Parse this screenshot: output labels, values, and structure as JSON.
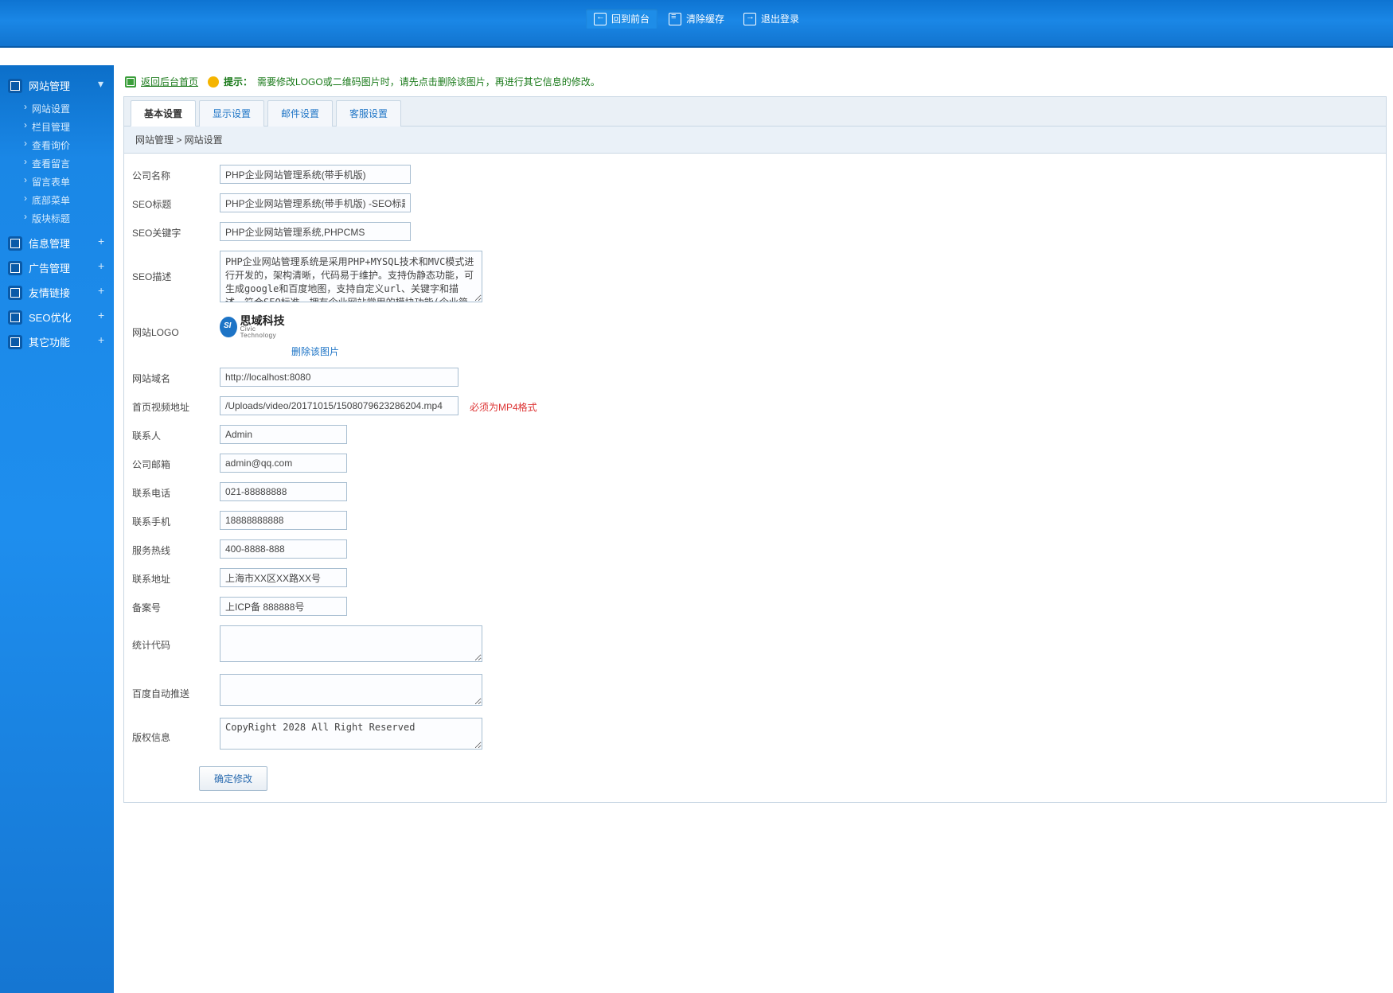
{
  "header": {
    "back_front": "回到前台",
    "clear_cache": "清除缓存",
    "logout": "退出登录"
  },
  "sidebar": {
    "groups": [
      {
        "title": "网站管理",
        "toggle": "▾",
        "open": true,
        "items": [
          "网站设置",
          "栏目管理",
          "查看询价",
          "查看留言",
          "留言表单",
          "底部菜单",
          "版块标题"
        ]
      },
      {
        "title": "信息管理",
        "toggle": "+"
      },
      {
        "title": "广告管理",
        "toggle": "+"
      },
      {
        "title": "友情链接",
        "toggle": "+"
      },
      {
        "title": "SEO优化",
        "toggle": "+"
      },
      {
        "title": "其它功能",
        "toggle": "+"
      }
    ]
  },
  "notice": {
    "back_link": "返回后台首页",
    "tip_label": "提示：",
    "tip_text": "需要修改LOGO或二维码图片时，请先点击删除该图片，再进行其它信息的修改。"
  },
  "tabs": [
    "基本设置",
    "显示设置",
    "邮件设置",
    "客服设置"
  ],
  "breadcrumb": "网站管理 > 网站设置",
  "form": {
    "company_name": {
      "label": "公司名称",
      "value": "PHP企业网站管理系统(带手机版)"
    },
    "seo_title": {
      "label": "SEO标题",
      "value": "PHP企业网站管理系统(带手机版) -SEO标题优化"
    },
    "seo_keywords": {
      "label": "SEO关键字",
      "value": "PHP企业网站管理系统,PHPCMS"
    },
    "seo_desc": {
      "label": "SEO描述",
      "value": "PHP企业网站管理系统是采用PHP+MYSQL技术和MVC模式进行开发的，架构清晰，代码易于维护。支持伪静态功能，可生成google和百度地图，支持自定义url、关键字和描述，符合SEO标准。拥有企业网站常用的模块功能(企业简介模块、新闻模块、产品模块、下载模块、"
    },
    "site_logo": {
      "label": "网站LOGO",
      "logo_cn": "思域科技",
      "logo_en": "Civic Technology",
      "delete_link": "删除该图片"
    },
    "site_domain": {
      "label": "网站域名",
      "value": "http://localhost:8080"
    },
    "home_video": {
      "label": "首页视频地址",
      "value": "/Uploads/video/20171015/1508079623286204.mp4",
      "note": "必须为MP4格式"
    },
    "contact": {
      "label": "联系人",
      "value": "Admin"
    },
    "email": {
      "label": "公司邮箱",
      "value": "admin@qq.com"
    },
    "tel": {
      "label": "联系电话",
      "value": "021-88888888"
    },
    "mobile": {
      "label": "联系手机",
      "value": "18888888888"
    },
    "hotline": {
      "label": "服务热线",
      "value": "400-8888-888"
    },
    "address": {
      "label": "联系地址",
      "value": "上海市XX区XX路XX号"
    },
    "icp": {
      "label": "备案号",
      "value": "上ICP备 888888号"
    },
    "stats_code": {
      "label": "统计代码",
      "value": ""
    },
    "baidu_push": {
      "label": "百度自动推送",
      "value": ""
    },
    "copyright": {
      "label": "版权信息",
      "value": "CopyRight 2028 All Right Reserved"
    },
    "submit": "确定修改"
  }
}
